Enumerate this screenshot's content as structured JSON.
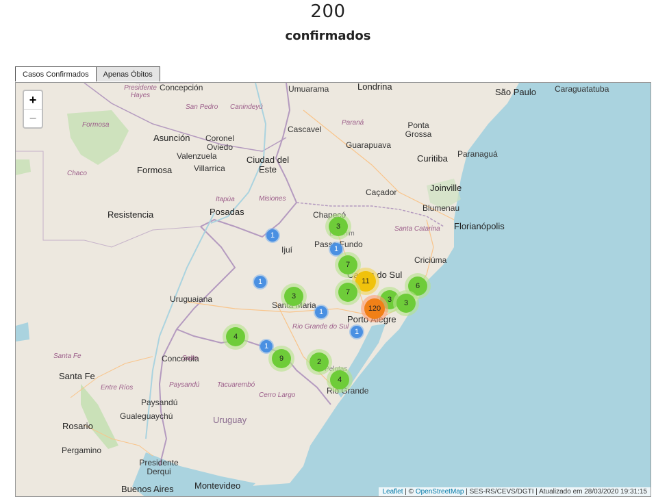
{
  "summary": {
    "count": "200",
    "label": "confirmados"
  },
  "tabs": [
    {
      "label": "Casos Confirmados",
      "active": true
    },
    {
      "label": "Apenas Óbitos",
      "active": false
    }
  ],
  "zoom": {
    "in": "+",
    "out": "−"
  },
  "attribution": {
    "leaflet": "Leaflet",
    "sep1": " | © ",
    "osm": "OpenStreetMap",
    "rest": " | SES-RS/CEVS/DGTI | Atualizado em 28/03/2020 19:31:15"
  },
  "places": [
    {
      "name": "Presidente Hayes",
      "cls": "region"
    },
    {
      "name": "Concepción",
      "cls": "city"
    },
    {
      "name": "San Pedro",
      "cls": "region"
    },
    {
      "name": "Canindeyú",
      "cls": "region"
    },
    {
      "name": "Umuarama",
      "cls": "city"
    },
    {
      "name": "Londrina",
      "cls": "big"
    },
    {
      "name": "São Paulo",
      "cls": "big"
    },
    {
      "name": "Caraguatatuba",
      "cls": "city"
    },
    {
      "name": "Formosa",
      "cls": "region"
    },
    {
      "name": "Paraná",
      "cls": "region"
    },
    {
      "name": "Cascavel",
      "cls": "city"
    },
    {
      "name": "Ponta Grossa",
      "cls": "city"
    },
    {
      "name": "Asunción",
      "cls": "big"
    },
    {
      "name": "Coronel Oviedo",
      "cls": "city"
    },
    {
      "name": "Guarapuava",
      "cls": "city"
    },
    {
      "name": "Valenzuela",
      "cls": "city"
    },
    {
      "name": "Ciudad del Este",
      "cls": "big"
    },
    {
      "name": "Curitiba",
      "cls": "big"
    },
    {
      "name": "Paranaguá",
      "cls": "city"
    },
    {
      "name": "Formosa",
      "cls": "big"
    },
    {
      "name": "Villarrica",
      "cls": "city"
    },
    {
      "name": "Chaco",
      "cls": "region"
    },
    {
      "name": "Itapúa",
      "cls": "region"
    },
    {
      "name": "Joinville",
      "cls": "big"
    },
    {
      "name": "Caçador",
      "cls": "city"
    },
    {
      "name": "Misiones",
      "cls": "region"
    },
    {
      "name": "Blumenau",
      "cls": "city"
    },
    {
      "name": "Resistencia",
      "cls": "big"
    },
    {
      "name": "Posadas",
      "cls": "big"
    },
    {
      "name": "Chapecó",
      "cls": "city"
    },
    {
      "name": "Florianópolis",
      "cls": "big"
    },
    {
      "name": "Santa Catarina",
      "cls": "region"
    },
    {
      "name": "Erechim",
      "cls": "faint"
    },
    {
      "name": "Passo Fundo",
      "cls": "city"
    },
    {
      "name": "Ijuí",
      "cls": "city"
    },
    {
      "name": "Criciúma",
      "cls": "city"
    },
    {
      "name": "Caxias do Sul",
      "cls": "big"
    },
    {
      "name": "Uruguaiana",
      "cls": "city"
    },
    {
      "name": "Santa Maria",
      "cls": "city"
    },
    {
      "name": "Porto Alegre",
      "cls": "big"
    },
    {
      "name": "Rio Grande do Sul",
      "cls": "region"
    },
    {
      "name": "Santa Fe",
      "cls": "region"
    },
    {
      "name": "Concordia",
      "cls": "city"
    },
    {
      "name": "Salto",
      "cls": "region"
    },
    {
      "name": "Santa Fe",
      "cls": "big"
    },
    {
      "name": "Pelotas",
      "cls": "faint"
    },
    {
      "name": "Rio Grande",
      "cls": "city"
    },
    {
      "name": "Entre Ríos",
      "cls": "region"
    },
    {
      "name": "Paysandú",
      "cls": "region"
    },
    {
      "name": "Tacuarembó",
      "cls": "region"
    },
    {
      "name": "Cerro Largo",
      "cls": "region"
    },
    {
      "name": "Paysandú",
      "cls": "city"
    },
    {
      "name": "Gualeguaychú",
      "cls": "city"
    },
    {
      "name": "Uruguay",
      "cls": "country"
    },
    {
      "name": "Rosario",
      "cls": "big"
    },
    {
      "name": "Pergamino",
      "cls": "city"
    },
    {
      "name": "Presidente Derqui",
      "cls": "city"
    },
    {
      "name": "Buenos Aires",
      "cls": "big"
    },
    {
      "name": "Montevideo",
      "cls": "big"
    }
  ],
  "clusters": [
    {
      "count": "3",
      "size": "medium"
    },
    {
      "count": "1",
      "size": "single"
    },
    {
      "count": "1",
      "size": "single"
    },
    {
      "count": "7",
      "size": "medium"
    },
    {
      "count": "11",
      "size": "large"
    },
    {
      "count": "1",
      "size": "single"
    },
    {
      "count": "6",
      "size": "medium"
    },
    {
      "count": "7",
      "size": "medium"
    },
    {
      "count": "3",
      "size": "medium"
    },
    {
      "count": "3",
      "size": "medium"
    },
    {
      "count": "3",
      "size": "medium"
    },
    {
      "count": "120",
      "size": "huge"
    },
    {
      "count": "1",
      "size": "single"
    },
    {
      "count": "1",
      "size": "single"
    },
    {
      "count": "4",
      "size": "medium"
    },
    {
      "count": "1",
      "size": "single"
    },
    {
      "count": "9",
      "size": "medium"
    },
    {
      "count": "2",
      "size": "medium"
    },
    {
      "count": "4",
      "size": "medium"
    }
  ]
}
